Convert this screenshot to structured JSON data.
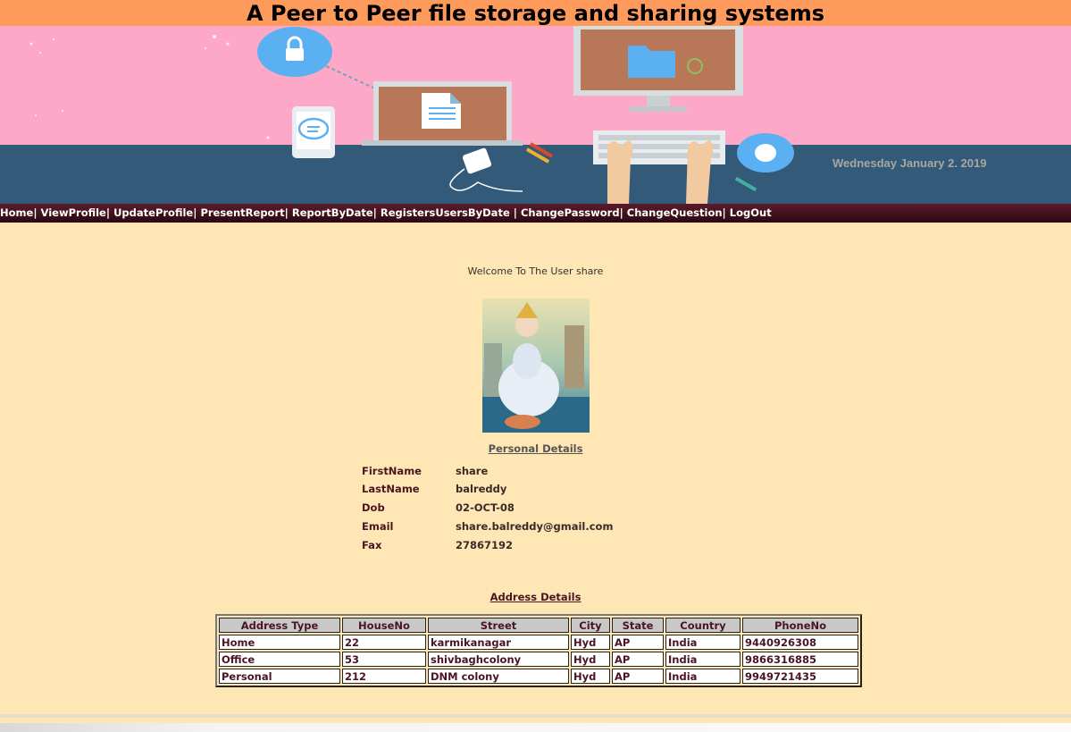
{
  "header": {
    "title": "A Peer to Peer file storage and sharing systems",
    "date": "Wednesday January 2. 2019"
  },
  "nav": {
    "items": [
      "Home",
      "ViewProfile",
      "UpdateProfile",
      "PresentReport",
      "ReportByDate",
      "RegistersUsersByDate",
      "ChangePassword",
      "ChangeQuestion",
      "LogOut"
    ]
  },
  "welcome": "Welcome To The User share",
  "personal": {
    "title": "Personal Details",
    "first_name_label": "FirstName",
    "first_name": "share",
    "last_name_label": "LastName",
    "last_name": "balreddy",
    "dob_label": "Dob",
    "dob": "02-OCT-08",
    "email_label": "Email",
    "email": "share.balreddy@gmail.com",
    "fax_label": "Fax",
    "fax": "27867192"
  },
  "address": {
    "title": "Address Details",
    "columns": [
      "Address Type",
      "HouseNo",
      "Street",
      "City",
      "State",
      "Country",
      "PhoneNo"
    ],
    "rows": [
      [
        "Home",
        "22",
        "karmikanagar",
        "Hyd",
        "AP",
        "India",
        "9440926308"
      ],
      [
        "Office",
        "53",
        "shivbaghcolony",
        "Hyd",
        "AP",
        "India",
        "9866316885"
      ],
      [
        "Personal",
        "212",
        "DNM colony",
        "Hyd",
        "AP",
        "India",
        "9949721435"
      ]
    ]
  },
  "colors": {
    "title_bar": "#fe9a5c",
    "banner_pink": "#fea8c8",
    "banner_floor": "#335a78",
    "nav_bg": "#3a0e18",
    "page_bg": "#fee7b4"
  },
  "icons": [
    "lock-icon",
    "chat-bubble-icon",
    "document-icon",
    "folder-icon",
    "mouse-icon",
    "keyboard-icon"
  ]
}
